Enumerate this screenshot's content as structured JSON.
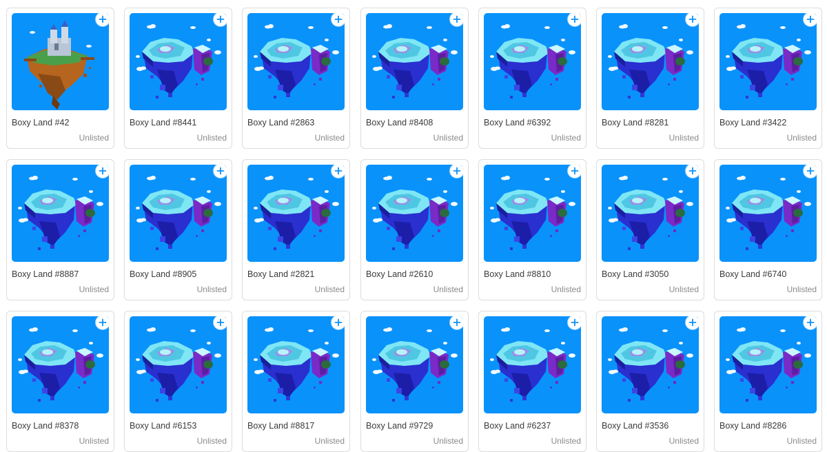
{
  "colors": {
    "tile_background": "#0a92fb",
    "add_button": "#ffffff",
    "add_icon": "#0a92fb",
    "name_text": "#3a3a3a",
    "status_text": "#8a8a8a"
  },
  "cards": [
    {
      "name": "Boxy Land #42",
      "status": "Unlisted",
      "art": "castle-island"
    },
    {
      "name": "Boxy Land #8441",
      "status": "Unlisted",
      "art": "ice-island"
    },
    {
      "name": "Boxy Land #2863",
      "status": "Unlisted",
      "art": "ice-island"
    },
    {
      "name": "Boxy Land #8408",
      "status": "Unlisted",
      "art": "ice-island"
    },
    {
      "name": "Boxy Land #6392",
      "status": "Unlisted",
      "art": "ice-island"
    },
    {
      "name": "Boxy Land #8281",
      "status": "Unlisted",
      "art": "ice-island"
    },
    {
      "name": "Boxy Land #3422",
      "status": "Unlisted",
      "art": "ice-island"
    },
    {
      "name": "Boxy Land #8887",
      "status": "Unlisted",
      "art": "ice-island"
    },
    {
      "name": "Boxy Land #8905",
      "status": "Unlisted",
      "art": "ice-island"
    },
    {
      "name": "Boxy Land #2821",
      "status": "Unlisted",
      "art": "ice-island"
    },
    {
      "name": "Boxy Land #2610",
      "status": "Unlisted",
      "art": "ice-island"
    },
    {
      "name": "Boxy Land #8810",
      "status": "Unlisted",
      "art": "ice-island"
    },
    {
      "name": "Boxy Land #3050",
      "status": "Unlisted",
      "art": "ice-island"
    },
    {
      "name": "Boxy Land #6740",
      "status": "Unlisted",
      "art": "ice-island"
    },
    {
      "name": "Boxy Land #8378",
      "status": "Unlisted",
      "art": "ice-island"
    },
    {
      "name": "Boxy Land #6153",
      "status": "Unlisted",
      "art": "ice-island"
    },
    {
      "name": "Boxy Land #8817",
      "status": "Unlisted",
      "art": "ice-island"
    },
    {
      "name": "Boxy Land #9729",
      "status": "Unlisted",
      "art": "ice-island"
    },
    {
      "name": "Boxy Land #6237",
      "status": "Unlisted",
      "art": "ice-island"
    },
    {
      "name": "Boxy Land #3536",
      "status": "Unlisted",
      "art": "ice-island"
    },
    {
      "name": "Boxy Land #8286",
      "status": "Unlisted",
      "art": "ice-island"
    }
  ],
  "icons": {
    "add": "plus-circle-icon"
  }
}
